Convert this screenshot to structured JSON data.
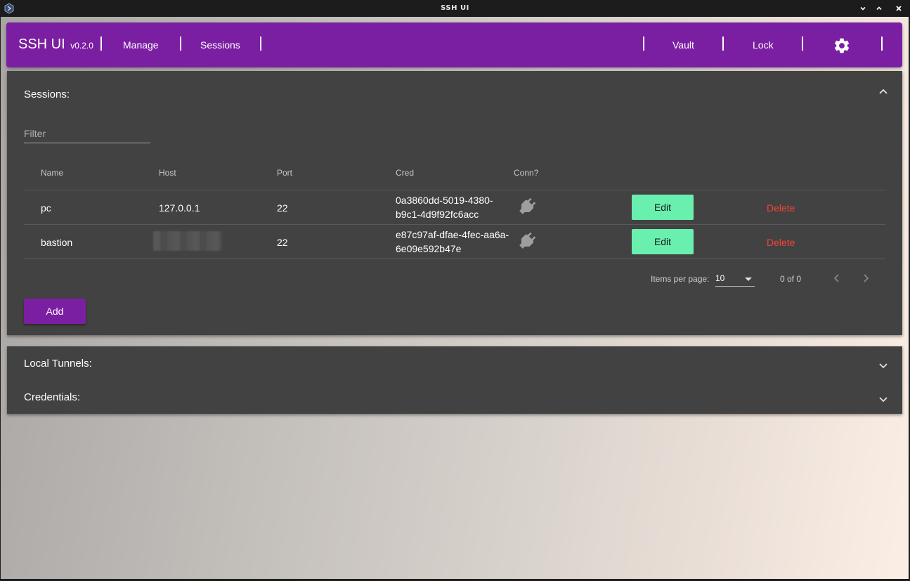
{
  "window": {
    "title": "SSH UI"
  },
  "navbar": {
    "brand": "SSH UI",
    "version": "v0.2.0",
    "links": {
      "manage": "Manage",
      "sessions": "Sessions",
      "vault": "Vault",
      "lock": "Lock"
    },
    "settings_icon": "gear-icon"
  },
  "sessions": {
    "title": "Sessions:",
    "filter_placeholder": "Filter",
    "columns": {
      "name": "Name",
      "host": "Host",
      "port": "Port",
      "cred": "Cred",
      "conn": "Conn?"
    },
    "rows": [
      {
        "name": "pc",
        "host": "127.0.0.1",
        "port": "22",
        "cred_line1": "0a3860dd-5019-4380-",
        "cred_line2": "b9c1-4d9f92fc6acc",
        "conn_icon": "plug-icon",
        "edit": "Edit",
        "delete": "Delete"
      },
      {
        "name": "bastion",
        "host": "",
        "port": "22",
        "cred_line1": "e87c97af-dfae-4fec-aa6a-",
        "cred_line2": "6e09e592b47e",
        "conn_icon": "plug-icon",
        "edit": "Edit",
        "delete": "Delete"
      }
    ],
    "paginator": {
      "items_per_page_label": "Items per page:",
      "items_per_page": "10",
      "range": "0 of 0"
    },
    "add_label": "Add"
  },
  "local_tunnels": {
    "title": "Local Tunnels:"
  },
  "credentials": {
    "title": "Credentials:"
  },
  "colors": {
    "primary": "#7b1fa2",
    "accent": "#69f0ae",
    "warn": "#f44336",
    "panel": "#424242"
  }
}
